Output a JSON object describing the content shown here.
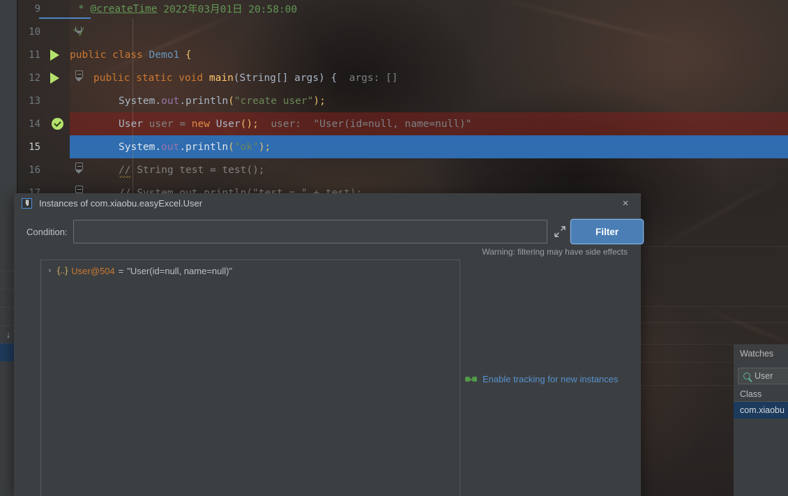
{
  "editor": {
    "lines": [
      {
        "num": "9",
        "state": "normal",
        "gutter": "none",
        "fold": "none"
      },
      {
        "num": "10",
        "state": "normal",
        "gutter": "none",
        "fold": "fold-end"
      },
      {
        "num": "11",
        "state": "normal",
        "gutter": "run",
        "fold": "none"
      },
      {
        "num": "12",
        "state": "normal",
        "gutter": "run",
        "fold": "fold-open"
      },
      {
        "num": "13",
        "state": "normal",
        "gutter": "none",
        "fold": "none"
      },
      {
        "num": "14",
        "state": "error",
        "gutter": "check",
        "fold": "none"
      },
      {
        "num": "15",
        "state": "current",
        "gutter": "none",
        "fold": "none"
      },
      {
        "num": "16",
        "state": "normal",
        "gutter": "none",
        "fold": "fold-open"
      },
      {
        "num": "17",
        "state": "normal",
        "gutter": "none",
        "fold": "fold-open"
      }
    ],
    "code": {
      "l9_star": "*",
      "l9_tag": "@createTime",
      "l9_date": "2022年03月01日 20:58:00",
      "l10": "*/",
      "l11_kw": "public class",
      "l11_name": "Demo1",
      "l11_brace": "{",
      "l12_kw": "public static void",
      "l12_name": "main",
      "l12_sig": "(String[] args) {",
      "l12_hint": "args: []",
      "l13_sys": "System.",
      "l13_out": "out",
      "l13_dot": ".",
      "l13_meth": "println",
      "l13_open": "(",
      "l13_str": "\"create user\"",
      "l13_close": ");",
      "l14_type": "User",
      "l14_var": "user",
      "l14_eq": "=",
      "l14_new": "new",
      "l14_ctor": "User",
      "l14_tail": "();",
      "l14_hint": "user:  \"User(id=null, name=null)\"",
      "l15_sys": "System.",
      "l15_out": "out",
      "l15_dot": ".",
      "l15_meth": "println",
      "l15_open": "(",
      "l15_str": "\"ok\"",
      "l15_close": ");",
      "l16_slashes": "//",
      "l16_rest": " String test = test();",
      "l17": "// System.out.println(\"test = \" + test);"
    }
  },
  "dialog": {
    "title": "Instances of com.xiaobu.easyExcel.User",
    "icon_label": "IJ",
    "close_label": "×",
    "condition": {
      "label": "Condition:",
      "value": "",
      "placeholder": ""
    },
    "expand_icon_name": "expand-editor-icon",
    "filter_button": "Filter",
    "warning": "Warning: filtering may have side effects",
    "tree": {
      "items": [
        {
          "arrow": "›",
          "braces": "{..}",
          "name": "User@504",
          "equals": "=",
          "value": "\"User(id=null, name=null)\""
        }
      ]
    },
    "tracking_link": "Enable tracking for new instances"
  },
  "watches_panel": {
    "tab_label": "Watches",
    "search_value": "User",
    "column_header": "Class",
    "rows": [
      "com.xiaobu"
    ]
  },
  "debug_toolbar": {
    "buttons": [
      {
        "icon": "step-down-icon",
        "selected": false
      },
      {
        "icon": "frame-selected-icon",
        "selected": true
      }
    ]
  },
  "colors": {
    "accent_blue": "#4a7eb5",
    "panel_bg": "#3c3f41",
    "selection_blue": "#2f6cb0",
    "error_red": "#80201c",
    "link_blue": "#5791d1",
    "gutter_green": "#b4e26d"
  }
}
